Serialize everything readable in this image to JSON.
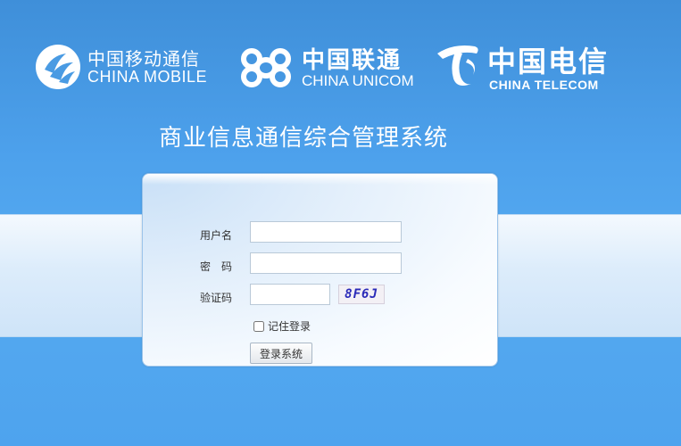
{
  "logos": {
    "china_mobile": {
      "cn": "中国移动通信",
      "en": "CHINA MOBILE",
      "icon": "china-mobile-logo-icon"
    },
    "china_unicom": {
      "cn": "中国联通",
      "en": "CHINA UNICOM",
      "icon": "china-unicom-logo-icon"
    },
    "china_telecom": {
      "cn": "中国电信",
      "en": "CHINA TELECOM",
      "icon": "china-telecom-logo-icon"
    }
  },
  "title": "商业信息通信综合管理系统",
  "form": {
    "username_label": "用户名",
    "username_value": "",
    "password_label": "密　码",
    "password_value": "",
    "captcha_label": "验证码",
    "captcha_value": "",
    "captcha_text": "8F6J",
    "remember_label": "记住登录",
    "remember_checked": false,
    "submit_label": "登录系统"
  },
  "colors": {
    "background": "#4da1ec",
    "band": "#dcecfb",
    "captcha_text": "#2a2ab8"
  }
}
